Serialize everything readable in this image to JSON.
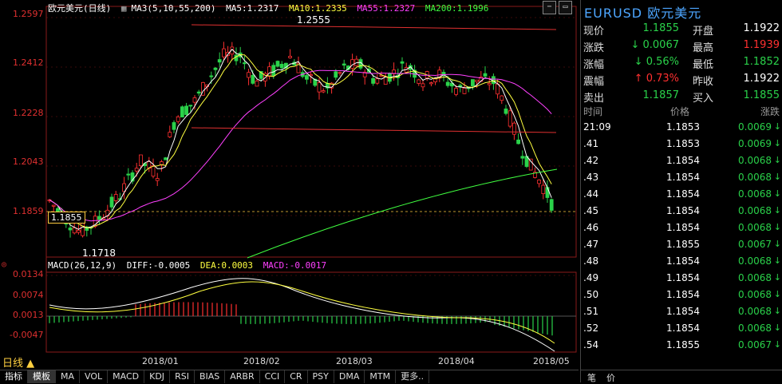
{
  "main": {
    "symbol_name": "欧元美元",
    "period": "(日线)",
    "ma_header": "MA3(5,10,55,200)",
    "ma": [
      {
        "label": "MA5:1.2317",
        "color": "#ffffff"
      },
      {
        "label": "MA10:1.2335",
        "color": "#ffff40"
      },
      {
        "label": "MA55:1.2327",
        "color": "#ff40ff"
      },
      {
        "label": "MA200:1.1996",
        "color": "#40ff40"
      }
    ],
    "y_ticks": [
      "1.2597",
      "1.2412",
      "1.2228",
      "1.2043",
      "1.1859"
    ],
    "high_marker": "1.2555",
    "low_marker": "1.1718",
    "current_price_label": "1.1855",
    "x_ticks": [
      "2018/01",
      "2018/02",
      "2018/03",
      "2018/04",
      "2018/05"
    ],
    "period_button": "日线",
    "indicator_tabs": [
      "指标",
      "模板",
      "MA",
      "VOL",
      "MACD",
      "KDJ",
      "RSI",
      "BIAS",
      "ARBR",
      "CCI",
      "CR",
      "PSY",
      "DMA",
      "MTM",
      "更多.."
    ]
  },
  "macd": {
    "header": "MACD(26,12,9)",
    "diff": "DIFF:-0.0005",
    "dea": "DEA:0.0003",
    "macd": "MACD:-0.0017",
    "y_ticks": [
      "0.0134",
      "0.0074",
      "0.0013",
      "-0.0047"
    ]
  },
  "panel": {
    "title": "EURUSD 欧元美元",
    "quote_rows": [
      {
        "l1": "现价",
        "v1": "1.1855",
        "c1": "fall",
        "l2": "开盘",
        "v2": "1.1922",
        "c2": "white"
      },
      {
        "l1": "涨跌",
        "v1": "↓ 0.0067",
        "c1": "fall",
        "l2": "最高",
        "v2": "1.1939",
        "c2": "rise"
      },
      {
        "l1": "涨幅",
        "v1": "↓ 0.56%",
        "c1": "fall",
        "l2": "最低",
        "v2": "1.1852",
        "c2": "fall"
      },
      {
        "l1": "震幅",
        "v1": "↑ 0.73%",
        "c1": "rise",
        "l2": "昨收",
        "v2": "1.1922",
        "c2": "white"
      },
      {
        "l1": "卖出",
        "v1": "1.1857",
        "c1": "fall",
        "l2": "买入",
        "v2": "1.1855",
        "c2": "fall"
      }
    ],
    "tick_headers": {
      "time": "时间",
      "price": "价格",
      "change": "涨跌"
    },
    "ticks": [
      {
        "time": "21:09",
        "price": "1.1853",
        "change": "0.0069"
      },
      {
        "time": ".41",
        "price": "1.1853",
        "change": "0.0069"
      },
      {
        "time": ".42",
        "price": "1.1854",
        "change": "0.0068"
      },
      {
        "time": ".43",
        "price": "1.1854",
        "change": "0.0068"
      },
      {
        "time": ".44",
        "price": "1.1854",
        "change": "0.0068"
      },
      {
        "time": ".45",
        "price": "1.1854",
        "change": "0.0068"
      },
      {
        "time": ".46",
        "price": "1.1854",
        "change": "0.0068"
      },
      {
        "time": ".47",
        "price": "1.1855",
        "change": "0.0067"
      },
      {
        "time": ".48",
        "price": "1.1854",
        "change": "0.0068"
      },
      {
        "time": ".49",
        "price": "1.1854",
        "change": "0.0068"
      },
      {
        "time": ".50",
        "price": "1.1854",
        "change": "0.0068"
      },
      {
        "time": ".51",
        "price": "1.1854",
        "change": "0.0068"
      },
      {
        "time": ".52",
        "price": "1.1854",
        "change": "0.0068"
      },
      {
        "time": ".54",
        "price": "1.1855",
        "change": "0.0067"
      }
    ],
    "bottom_tabs": [
      "笔",
      "价"
    ]
  },
  "colors": {
    "up": "#ff3030",
    "down": "#2ad24a",
    "axis": "#e03030",
    "grid": "#5a1010"
  }
}
